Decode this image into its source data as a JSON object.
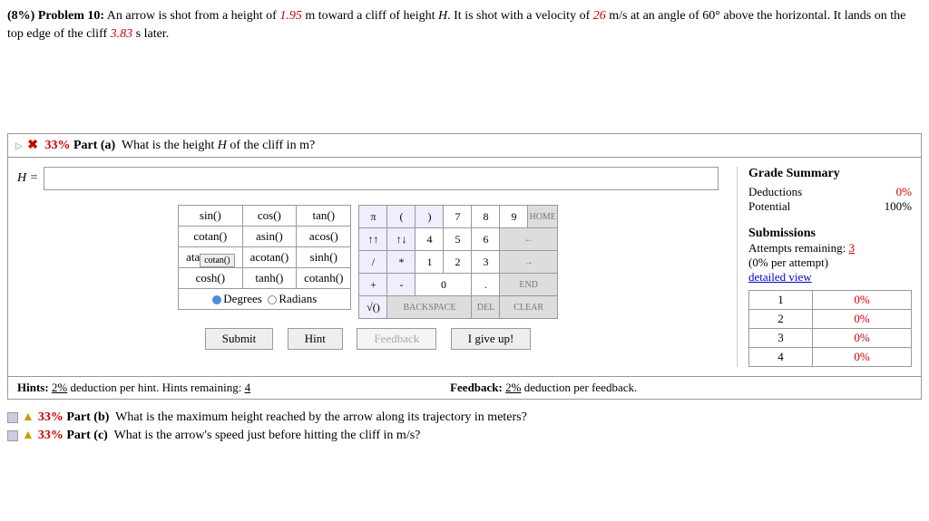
{
  "problem": {
    "prefix": "(8%) Problem 10:",
    "t1": " An arrow is shot from a height of ",
    "h0": "1.95",
    "t2": " m toward a cliff of height ",
    "Hsym": "H",
    "t3": ". It is shot with a velocity of ",
    "v0": "26",
    "t4": " m/s at an angle of 60° above the horizontal. It lands on the top edge of the cliff ",
    "tland": "3.83",
    "t5": " s later."
  },
  "partA": {
    "pct": "33%",
    "label": "Part (a)",
    "question": "What is the height H of the cliff in m?",
    "var": "H =",
    "value": ""
  },
  "funcs": {
    "r1": [
      "sin()",
      "cos()",
      "tan()"
    ],
    "r2": [
      "cotan()",
      "asin()",
      "acos()"
    ],
    "r3": [
      "atan()",
      "acotan()",
      "sinh()"
    ],
    "r4": [
      "cosh()",
      "tanh()",
      "cotanh()"
    ],
    "tooltip": "cotan()",
    "deg": "Degrees",
    "rad": "Radians"
  },
  "nums": {
    "r1": [
      "π",
      "(",
      ")",
      "7",
      "8",
      "9",
      "HOME"
    ],
    "r2": [
      "↑↑",
      "↑↓",
      "4",
      "5",
      "6",
      "←"
    ],
    "r3": [
      "/",
      "*",
      "1",
      "2",
      "3",
      "→"
    ],
    "r4": [
      "+",
      "-",
      "0",
      ".",
      "END"
    ],
    "r5": [
      "√()",
      "BACKSPACE",
      "DEL",
      "CLEAR"
    ]
  },
  "actions": {
    "submit": "Submit",
    "hint": "Hint",
    "feedback": "Feedback",
    "giveup": "I give up!"
  },
  "grade": {
    "title": "Grade Summary",
    "ded_l": "Deductions",
    "ded_v": "0%",
    "pot_l": "Potential",
    "pot_v": "100%"
  },
  "subs": {
    "title": "Submissions",
    "att_l": "Attempts remaining: ",
    "att_v": "3",
    "per": "(0% per attempt)",
    "detail": "detailed view",
    "rows": [
      [
        "1",
        "0%"
      ],
      [
        "2",
        "0%"
      ],
      [
        "3",
        "0%"
      ],
      [
        "4",
        "0%"
      ]
    ]
  },
  "hints": {
    "l1a": "Hints: ",
    "l1b": "2%",
    "l1c": " deduction per hint. Hints remaining: ",
    "l1d": "4",
    "l2a": "Feedback: ",
    "l2b": "2%",
    "l2c": " deduction per feedback."
  },
  "partB": {
    "pct": "33%",
    "label": "Part (b)",
    "q": "What is the maximum height reached by the arrow along its trajectory in meters?"
  },
  "partC": {
    "pct": "33%",
    "label": "Part (c)",
    "q": "What is the arrow's speed just before hitting the cliff in m/s?"
  }
}
